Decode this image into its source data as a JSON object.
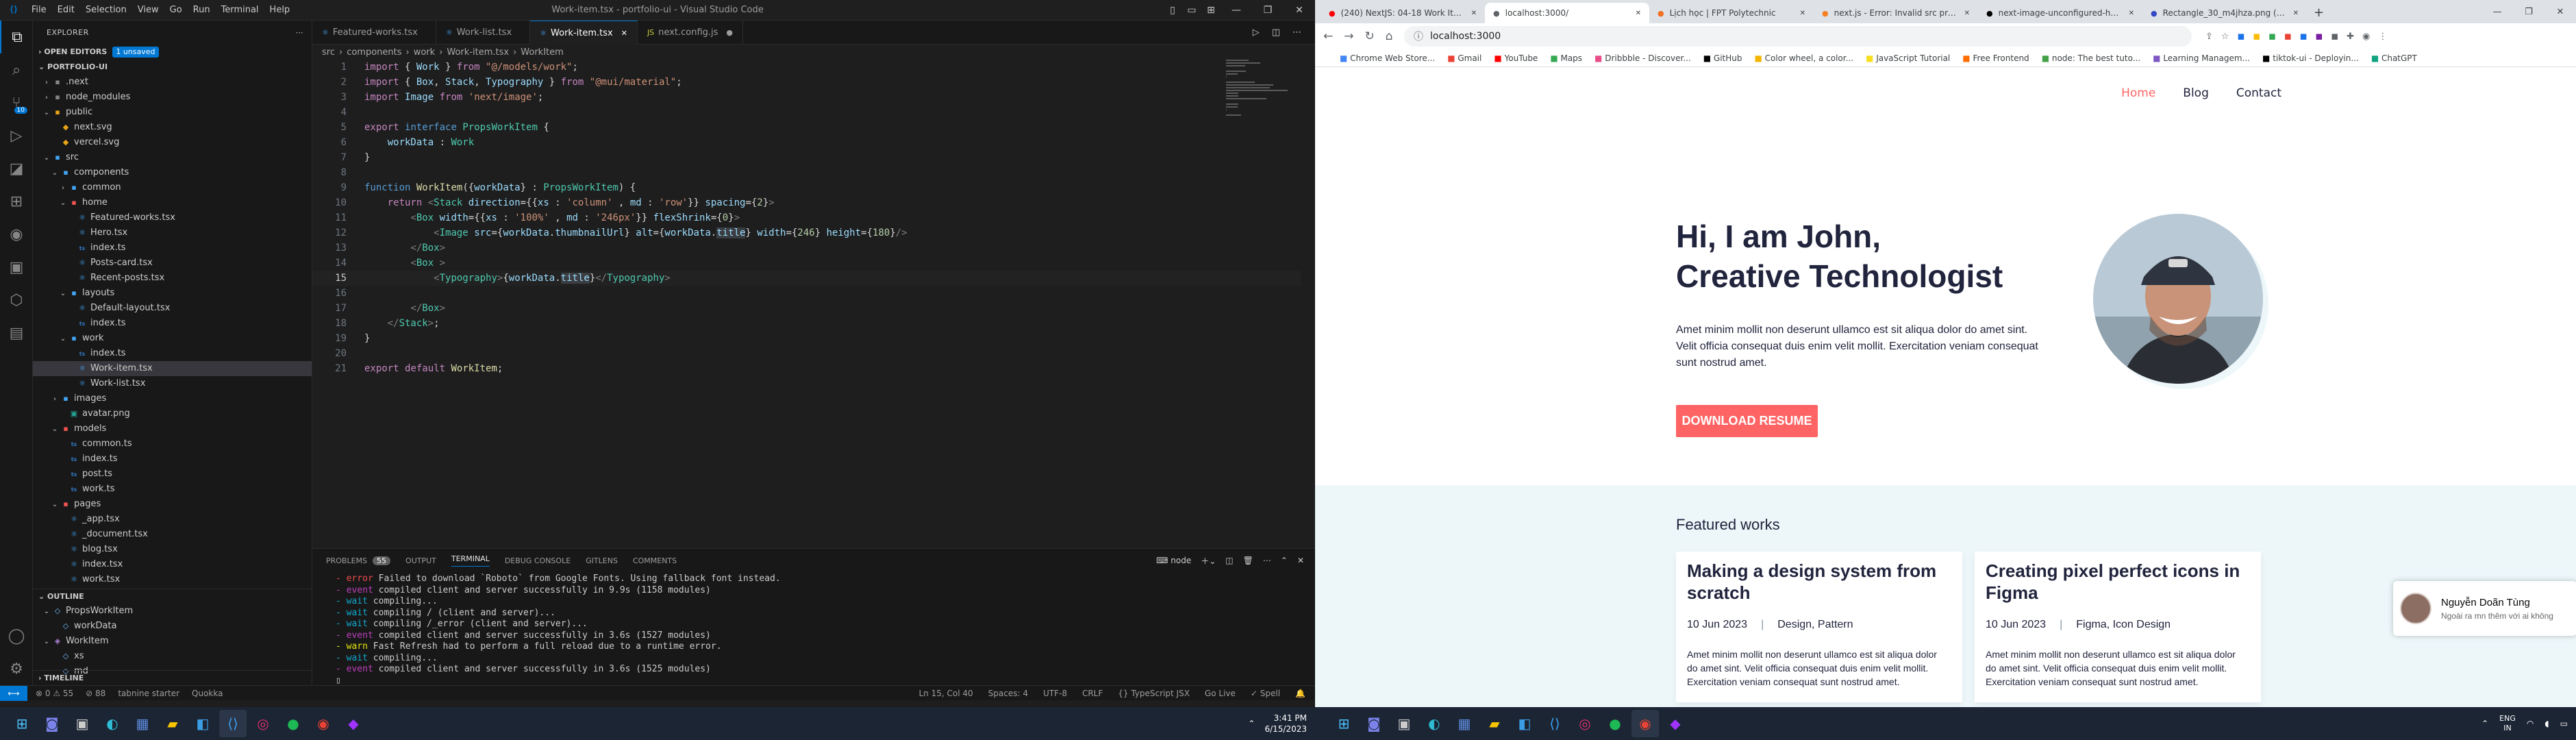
{
  "vscode": {
    "menu": [
      "File",
      "Edit",
      "Selection",
      "View",
      "Go",
      "Run",
      "Terminal",
      "Help"
    ],
    "title": "Work-item.tsx - portfolio-ui - Visual Studio Code",
    "explorer_label": "EXPLORER",
    "open_editors": "OPEN EDITORS",
    "unsaved": "1 unsaved",
    "project": "PORTFOLIO-UI",
    "tree": [
      {
        "d": 1,
        "tw": "›",
        "ic": "▪",
        "c": "#858585",
        "label": ".next"
      },
      {
        "d": 1,
        "tw": "›",
        "ic": "▪",
        "c": "#858585",
        "label": "node_modules"
      },
      {
        "d": 1,
        "tw": "⌄",
        "ic": "▪",
        "c": "#e8a317",
        "label": "public"
      },
      {
        "d": 2,
        "tw": "",
        "ic": "◆",
        "c": "#e8a317",
        "label": "next.svg"
      },
      {
        "d": 2,
        "tw": "",
        "ic": "◆",
        "c": "#e8a317",
        "label": "vercel.svg"
      },
      {
        "d": 1,
        "tw": "⌄",
        "ic": "▪",
        "c": "#42a5f5",
        "label": "src"
      },
      {
        "d": 2,
        "tw": "⌄",
        "ic": "▪",
        "c": "#42a5f5",
        "label": "components"
      },
      {
        "d": 3,
        "tw": "›",
        "ic": "▪",
        "c": "#42a5f5",
        "label": "common"
      },
      {
        "d": 3,
        "tw": "⌄",
        "ic": "▪",
        "c": "#ef5350",
        "label": "home"
      },
      {
        "d": 4,
        "tw": "",
        "ic": "⚛",
        "c": "#42a5f5",
        "label": "Featured-works.tsx"
      },
      {
        "d": 4,
        "tw": "",
        "ic": "⚛",
        "c": "#42a5f5",
        "label": "Hero.tsx"
      },
      {
        "d": 4,
        "tw": "",
        "ic": "ts",
        "c": "#3178c6",
        "label": "index.ts"
      },
      {
        "d": 4,
        "tw": "",
        "ic": "⚛",
        "c": "#42a5f5",
        "label": "Posts-card.tsx"
      },
      {
        "d": 4,
        "tw": "",
        "ic": "⚛",
        "c": "#42a5f5",
        "label": "Recent-posts.tsx"
      },
      {
        "d": 3,
        "tw": "⌄",
        "ic": "▪",
        "c": "#42a5f5",
        "label": "layouts"
      },
      {
        "d": 4,
        "tw": "",
        "ic": "⚛",
        "c": "#42a5f5",
        "label": "Default-layout.tsx"
      },
      {
        "d": 4,
        "tw": "",
        "ic": "ts",
        "c": "#3178c6",
        "label": "index.ts"
      },
      {
        "d": 3,
        "tw": "⌄",
        "ic": "▪",
        "c": "#42a5f5",
        "label": "work"
      },
      {
        "d": 4,
        "tw": "",
        "ic": "ts",
        "c": "#3178c6",
        "label": "index.ts"
      },
      {
        "d": 4,
        "tw": "",
        "ic": "⚛",
        "c": "#42a5f5",
        "label": "Work-item.tsx",
        "sel": true
      },
      {
        "d": 4,
        "tw": "",
        "ic": "⚛",
        "c": "#42a5f5",
        "label": "Work-list.tsx"
      },
      {
        "d": 2,
        "tw": "›",
        "ic": "▪",
        "c": "#42a5f5",
        "label": "images"
      },
      {
        "d": 3,
        "tw": "",
        "ic": "▣",
        "c": "#26a69a",
        "label": "avatar.png"
      },
      {
        "d": 2,
        "tw": "⌄",
        "ic": "▪",
        "c": "#ef5350",
        "label": "models"
      },
      {
        "d": 3,
        "tw": "",
        "ic": "ts",
        "c": "#3178c6",
        "label": "common.ts"
      },
      {
        "d": 3,
        "tw": "",
        "ic": "ts",
        "c": "#3178c6",
        "label": "index.ts"
      },
      {
        "d": 3,
        "tw": "",
        "ic": "ts",
        "c": "#3178c6",
        "label": "post.ts"
      },
      {
        "d": 3,
        "tw": "",
        "ic": "ts",
        "c": "#3178c6",
        "label": "work.ts"
      },
      {
        "d": 2,
        "tw": "⌄",
        "ic": "▪",
        "c": "#ef5350",
        "label": "pages"
      },
      {
        "d": 3,
        "tw": "",
        "ic": "⚛",
        "c": "#42a5f5",
        "label": "_app.tsx"
      },
      {
        "d": 3,
        "tw": "",
        "ic": "⚛",
        "c": "#42a5f5",
        "label": "_document.tsx"
      },
      {
        "d": 3,
        "tw": "",
        "ic": "⚛",
        "c": "#42a5f5",
        "label": "blog.tsx"
      },
      {
        "d": 3,
        "tw": "",
        "ic": "⚛",
        "c": "#42a5f5",
        "label": "index.tsx"
      },
      {
        "d": 3,
        "tw": "",
        "ic": "⚛",
        "c": "#42a5f5",
        "label": "work.tsx"
      }
    ],
    "outline": "OUTLINE",
    "outline_items": [
      {
        "d": 1,
        "tw": "⌄",
        "ic": "◇",
        "c": "#75beff",
        "label": "PropsWorkItem"
      },
      {
        "d": 2,
        "tw": "",
        "ic": "◇",
        "c": "#75beff",
        "label": "workData"
      },
      {
        "d": 1,
        "tw": "⌄",
        "ic": "◈",
        "c": "#b180d7",
        "label": "WorkItem"
      },
      {
        "d": 2,
        "tw": "",
        "ic": "◇",
        "c": "#75beff",
        "label": "xs"
      },
      {
        "d": 2,
        "tw": "",
        "ic": "◇",
        "c": "#75beff",
        "label": "md"
      }
    ],
    "timeline": "TIMELINE",
    "tabs": [
      {
        "label": "Featured-works.tsx",
        "active": false,
        "dot": false
      },
      {
        "label": "Work-list.tsx",
        "active": false,
        "dot": false
      },
      {
        "label": "Work-item.tsx",
        "active": true,
        "dot": false
      },
      {
        "label": "next.config.js",
        "active": false,
        "dot": true
      }
    ],
    "breadcrumb": [
      "src",
      "components",
      "work",
      "Work-item.tsx",
      "WorkItem"
    ],
    "code_lines": [
      "<span class=\"k\">import</span><span class=\"p\"> { </span><span class=\"v\">Work</span><span class=\"p\"> } </span><span class=\"k\">from</span><span class=\"p\"> </span><span class=\"s\">\"@/models/work\"</span><span class=\"p\">;</span>",
      "<span class=\"k\">import</span><span class=\"p\"> { </span><span class=\"v\">Box</span><span class=\"p\">, </span><span class=\"v\">Stack</span><span class=\"p\">, </span><span class=\"v\">Typography</span><span class=\"p\"> } </span><span class=\"k\">from</span><span class=\"p\"> </span><span class=\"s\">\"@mui/material\"</span><span class=\"p\">;</span>",
      "<span class=\"k\">import</span><span class=\"p\"> </span><span class=\"v\">Image</span><span class=\"p\"> </span><span class=\"k\">from</span><span class=\"p\"> </span><span class=\"s\">'next/image'</span><span class=\"p\">;</span>",
      "",
      "<span class=\"k\">export</span><span class=\"p\"> </span><span class=\"kb\">interface</span><span class=\"p\"> </span><span class=\"t\">PropsWorkItem</span><span class=\"p\"> {</span>",
      "<span class=\"p\">    </span><span class=\"v\">workData</span><span class=\"p\"> : </span><span class=\"t\">Work</span>",
      "<span class=\"p\">}</span>",
      "",
      "<span class=\"kb\">function</span><span class=\"p\"> </span><span class=\"f\">WorkItem</span><span class=\"p\">({</span><span class=\"v\">workData</span><span class=\"p\">} : </span><span class=\"t\">PropsWorkItem</span><span class=\"p\">) {</span>",
      "<span class=\"p\">    </span><span class=\"k\">return</span><span class=\"p\"> </span><span class=\"tg\">&lt;</span><span class=\"t\">Stack</span><span class=\"p\"> </span><span class=\"v\">direction</span><span class=\"p\">={{</span><span class=\"v\">xs</span><span class=\"p\"> : </span><span class=\"s\">'column'</span><span class=\"p\"> , </span><span class=\"v\">md</span><span class=\"p\"> : </span><span class=\"s\">'row'</span><span class=\"p\">}} </span><span class=\"v\">spacing</span><span class=\"p\">={</span><span class=\"n\">2</span><span class=\"p\">}</span><span class=\"tg\">&gt;</span>",
      "<span class=\"p\">        </span><span class=\"tg\">&lt;</span><span class=\"t\">Box</span><span class=\"p\"> </span><span class=\"v\">width</span><span class=\"p\">={{</span><span class=\"v\">xs</span><span class=\"p\"> : </span><span class=\"s\">'100%'</span><span class=\"p\"> , </span><span class=\"v\">md</span><span class=\"p\"> : </span><span class=\"s\">'246px'</span><span class=\"p\">}} </span><span class=\"v\">flexShrink</span><span class=\"p\">={</span><span class=\"n\">0</span><span class=\"p\">}</span><span class=\"tg\">&gt;</span>",
      "<span class=\"p\">            </span><span class=\"tg\">&lt;</span><span class=\"t\">Image</span><span class=\"p\"> </span><span class=\"v\">src</span><span class=\"p\">={</span><span class=\"v\">workData</span><span class=\"p\">.</span><span class=\"v\">thumbnailUrl</span><span class=\"p\">} </span><span class=\"v\">alt</span><span class=\"p\">={</span><span class=\"v\">workData</span><span class=\"p\">.</span><span class=\"v hl\">title</span><span class=\"p\">} </span><span class=\"v\">width</span><span class=\"p\">={</span><span class=\"n\">246</span><span class=\"p\">} </span><span class=\"v\">height</span><span class=\"p\">={</span><span class=\"n\">180</span><span class=\"p\">}</span><span class=\"tg\">/&gt;</span>",
      "<span class=\"p\">        </span><span class=\"tg\">&lt;/</span><span class=\"t\">Box</span><span class=\"tg\">&gt;</span>",
      "<span class=\"p\">        </span><span class=\"tg\">&lt;</span><span class=\"t\">Box</span><span class=\"p\"> </span><span class=\"tg\">&gt;</span>",
      "<span class=\"p\">            </span><span class=\"tg\">&lt;</span><span class=\"t\">Typography</span><span class=\"tg\">&gt;</span><span class=\"p\">{</span><span class=\"v\">workData</span><span class=\"p\">.</span><span class=\"v hl\">title</span><span class=\"p\">}</span><span class=\"tg\">&lt;/</span><span class=\"t\">Typography</span><span class=\"tg\">&gt;</span>",
      "",
      "<span class=\"p\">        </span><span class=\"tg\">&lt;/</span><span class=\"t\">Box</span><span class=\"tg\">&gt;</span>",
      "<span class=\"p\">    </span><span class=\"tg\">&lt;/</span><span class=\"t\">Stack</span><span class=\"tg\">&gt;</span><span class=\"p\">;</span>",
      "<span class=\"p\">}</span>",
      "",
      "<span class=\"k\">export</span><span class=\"p\"> </span><span class=\"k\">default</span><span class=\"p\"> </span><span class=\"f\">WorkItem</span><span class=\"p\">;</span>"
    ],
    "panel_tabs": [
      "PROBLEMS",
      "OUTPUT",
      "TERMINAL",
      "DEBUG CONSOLE",
      "GITLENS",
      "COMMENTS"
    ],
    "problems_count": "55",
    "terminal_shell": "node",
    "terminal": [
      {
        "tag": "- error",
        "c": "#f14c4c",
        "msg": " Failed to download `Roboto` from Google Fonts. Using fallback font instead."
      },
      {
        "tag": "- event",
        "c": "#bc3fbc",
        "msg": " compiled client and server successfully in 9.9s (1158 modules)"
      },
      {
        "tag": "- wait",
        "c": "#11a8cd",
        "msg": " compiling..."
      },
      {
        "tag": "- wait",
        "c": "#11a8cd",
        "msg": " compiling / (client and server)..."
      },
      {
        "tag": "- wait",
        "c": "#11a8cd",
        "msg": " compiling /_error (client and server)..."
      },
      {
        "tag": "- event",
        "c": "#bc3fbc",
        "msg": " compiled client and server successfully in 3.6s (1527 modules)"
      },
      {
        "tag": "- warn",
        "c": "#e5e510",
        "msg": " Fast Refresh had to perform a full reload due to a runtime error."
      },
      {
        "tag": "- wait",
        "c": "#11a8cd",
        "msg": " compiling..."
      },
      {
        "tag": "- event",
        "c": "#bc3fbc",
        "msg": " compiled client and server successfully in 3.6s (1525 modules)"
      }
    ],
    "status_left": [
      "⊗ 0 ⚠ 55",
      "⊘ 88",
      "tabnine starter",
      "Quokka"
    ],
    "status_right": [
      "Ln 15, Col 40",
      "Spaces: 4",
      "UTF-8",
      "CRLF",
      "{} TypeScript JSX",
      "Go Live",
      "✓ Spell"
    ]
  },
  "chrome": {
    "tabs": [
      {
        "label": "(240) NextJS: 04-18 Work Item U...",
        "color": "#ff0000",
        "active": false
      },
      {
        "label": "localhost:3000/",
        "color": "#5f6368",
        "active": true
      },
      {
        "label": "Lịch học | FPT Polytechnic",
        "color": "#f37021",
        "active": false
      },
      {
        "label": "next.js - Error: Invalid src prop o...",
        "color": "#f48024",
        "active": false
      },
      {
        "label": "next-image-unconfigured-host | ...",
        "color": "#000000",
        "active": false
      },
      {
        "label": "Rectangle_30_m4jhza.png (246×...",
        "color": "#3448c5",
        "active": false
      }
    ],
    "url": "localhost:3000",
    "bookmarks": [
      "Chrome Web Store...",
      "Gmail",
      "YouTube",
      "Maps",
      "Dribbble - Discover...",
      "GitHub",
      "Color wheel, a color...",
      "JavaScript Tutorial",
      "Free Frontend",
      "node: The best tuto...",
      "Learning Managem...",
      "tiktok-ui - Deployin...",
      "ChatGPT"
    ],
    "site": {
      "nav": [
        "Home",
        "Blog",
        "Contact"
      ],
      "hero_line1": "Hi, I am John,",
      "hero_line2": "Creative Technologist",
      "hero_text": "Amet minim mollit non deserunt ullamco est sit aliqua dolor do amet sint. Velit officia consequat duis enim velit mollit. Exercitation veniam consequat sunt nostrud amet.",
      "button": "DOWNLOAD RESUME",
      "featured": "Featured works",
      "cards": [
        {
          "title": "Making a design system from scratch",
          "date": "10 Jun 2023",
          "tags": "Design, Pattern",
          "body": "Amet minim mollit non deserunt ullamco est sit aliqua dolor do amet sint. Velit officia consequat duis enim velit mollit. Exercitation veniam consequat sunt nostrud amet."
        },
        {
          "title": "Creating pixel perfect icons in Figma",
          "date": "10 Jun 2023",
          "tags": "Figma, Icon Design",
          "body": "Amet minim mollit non deserunt ullamco est sit aliqua dolor do amet sint. Velit officia consequat duis enim velit mollit. Exercitation veniam consequat sunt nostrud amet."
        }
      ]
    },
    "chat_name": "Nguyễn Doãn Tùng",
    "chat_msg": "Ngoài ra mn thêm với ai không"
  },
  "taskbar": {
    "time": "3:41 PM",
    "date": "6/15/2023",
    "lang1": "ENG",
    "lang2": "IN"
  }
}
